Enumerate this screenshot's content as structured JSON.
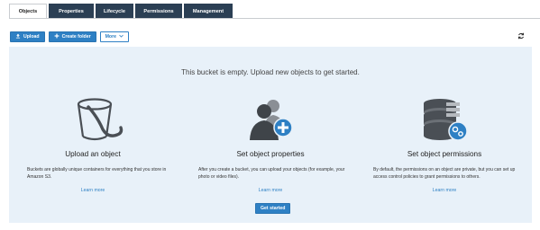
{
  "tabs": [
    {
      "label": "Objects",
      "active": true
    },
    {
      "label": "Properties",
      "active": false
    },
    {
      "label": "Lifecycle",
      "active": false
    },
    {
      "label": "Permissions",
      "active": false
    },
    {
      "label": "Management",
      "active": false
    }
  ],
  "toolbar": {
    "upload_label": "Upload",
    "upload_icon": "upload-icon",
    "create_folder_label": "Create folder",
    "create_folder_icon": "plus-icon",
    "more_label": "More",
    "more_icon": "chevron-down-icon",
    "refresh_icon": "refresh-icon"
  },
  "empty_state": {
    "message": "This bucket is empty. Upload new objects to get started.",
    "columns": [
      {
        "icon": "bucket-icon",
        "title": "Upload an object",
        "description": "Buckets are globally unique containers for everything that you store in Amazon S3.",
        "link": "Learn more"
      },
      {
        "icon": "users-add-icon",
        "title": "Set object properties",
        "description": "After you create a bucket, you can upload your objects (for example, your photo or video files).",
        "link": "Learn more"
      },
      {
        "icon": "database-permissions-icon",
        "title": "Set object permissions",
        "description": "By default, the permissions on an object are private, but you can set up access control policies to grant permissions to others.",
        "link": "Learn more"
      }
    ],
    "get_started_label": "Get started"
  },
  "colors": {
    "tab_dark": "#2b3f54",
    "primary_blue": "#2e80c4",
    "panel_bg": "#e8f1f9",
    "icon_dark": "#4a4f55"
  }
}
